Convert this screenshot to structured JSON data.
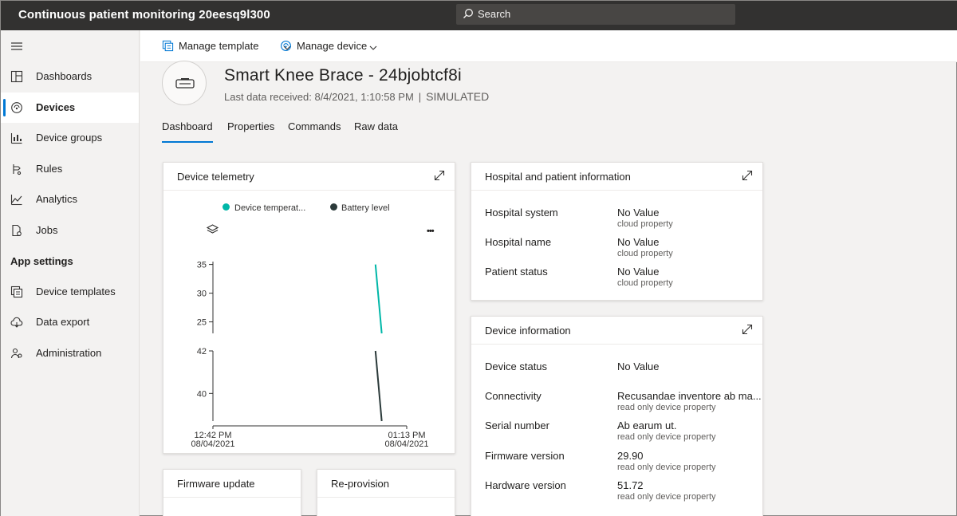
{
  "app": {
    "title": "Continuous patient monitoring 20eesq9l300"
  },
  "search": {
    "label": "Search"
  },
  "sidebar": {
    "items": [
      {
        "label": "Dashboards",
        "icon": "dashboard-icon"
      },
      {
        "label": "Devices",
        "icon": "devices-icon"
      },
      {
        "label": "Device groups",
        "icon": "device-groups-icon"
      },
      {
        "label": "Rules",
        "icon": "rules-icon"
      },
      {
        "label": "Analytics",
        "icon": "analytics-icon"
      },
      {
        "label": "Jobs",
        "icon": "jobs-icon"
      }
    ],
    "section_label": "App settings",
    "settings_items": [
      {
        "label": "Device templates",
        "icon": "device-templates-icon"
      },
      {
        "label": "Data export",
        "icon": "data-export-icon"
      },
      {
        "label": "Administration",
        "icon": "administration-icon"
      }
    ]
  },
  "cmdbar": {
    "manage_template": "Manage template",
    "manage_device": "Manage device"
  },
  "device": {
    "title": "Smart Knee Brace - 24bjobtcf8i",
    "last_data": "Last data received: 8/4/2021, 1:10:58 PM",
    "separator": "|",
    "mode": "SIMULATED"
  },
  "tabs": [
    "Dashboard",
    "Properties",
    "Commands",
    "Raw data"
  ],
  "telemetry": {
    "title": "Device telemetry",
    "more": "•••",
    "legend": [
      {
        "name": "Device temperat...",
        "color": "#00b7a8"
      },
      {
        "name": "Battery level",
        "color": "#2b3a3a"
      }
    ]
  },
  "chart_data": {
    "type": "line",
    "panels": [
      {
        "series": "Device temperat...",
        "color": "#00b7a8",
        "yticks": [
          35,
          30,
          25
        ],
        "ylim": [
          23,
          35.5
        ],
        "points": [
          {
            "x": "01:08 PM",
            "y": 35
          },
          {
            "x": "01:09 PM",
            "y": 23
          }
        ]
      },
      {
        "series": "Battery level",
        "color": "#2b3a3a",
        "yticks": [
          42,
          40
        ],
        "ylim": [
          38.7,
          42
        ],
        "points": [
          {
            "x": "01:08 PM",
            "y": 42
          },
          {
            "x": "01:09 PM",
            "y": 38.7
          }
        ]
      }
    ],
    "xticks": [
      {
        "time": "12:42 PM",
        "date": "08/04/2021"
      },
      {
        "time": "01:13 PM",
        "date": "08/04/2021"
      }
    ],
    "xrange": [
      "12:42 PM",
      "01:13 PM"
    ]
  },
  "hospital": {
    "title": "Hospital and patient information",
    "rows": [
      {
        "label": "Hospital system",
        "value": "No Value",
        "hint": "cloud property"
      },
      {
        "label": "Hospital name",
        "value": "No Value",
        "hint": "cloud property"
      },
      {
        "label": "Patient status",
        "value": "No Value",
        "hint": "cloud property"
      }
    ]
  },
  "deviceinfo": {
    "title": "Device information",
    "rows": [
      {
        "label": "Device status",
        "value": "No Value",
        "hint": ""
      },
      {
        "label": "Connectivity",
        "value": "Recusandae inventore ab ma...",
        "hint": "read only device property"
      },
      {
        "label": "Serial number",
        "value": "Ab earum ut.",
        "hint": "read only device property"
      },
      {
        "label": "Firmware version",
        "value": "29.90",
        "hint": "read only device property"
      },
      {
        "label": "Hardware version",
        "value": "51.72",
        "hint": "read only device property"
      }
    ]
  },
  "firmware": {
    "title": "Firmware update"
  },
  "reprovision": {
    "title": "Re-provision"
  }
}
